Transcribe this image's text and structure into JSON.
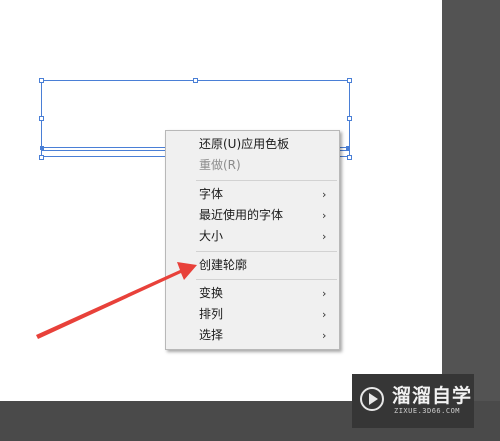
{
  "context_menu": {
    "items": [
      {
        "label": "还原(U)应用色板",
        "disabled": false,
        "submenu": false
      },
      {
        "label": "重做(R)",
        "disabled": true,
        "submenu": false
      },
      {
        "label": "字体",
        "disabled": false,
        "submenu": true
      },
      {
        "label": "最近使用的字体",
        "disabled": false,
        "submenu": true
      },
      {
        "label": "大小",
        "disabled": false,
        "submenu": true
      },
      {
        "label": "创建轮廓",
        "disabled": false,
        "submenu": false
      },
      {
        "label": "变换",
        "disabled": false,
        "submenu": true
      },
      {
        "label": "排列",
        "disabled": false,
        "submenu": true
      },
      {
        "label": "选择",
        "disabled": false,
        "submenu": true
      }
    ],
    "submenu_arrow": "›"
  },
  "watermark": {
    "name": "溜溜自学",
    "url": "ZIXUE.3D66.COM",
    "icon": "play-circle-icon"
  },
  "annotation": {
    "color": "#e8413a",
    "icon": "red-arrow-pointer"
  },
  "colors": {
    "selection": "#4a7fd6",
    "menu_bg": "#f0f0f0",
    "workspace": "#535353"
  }
}
